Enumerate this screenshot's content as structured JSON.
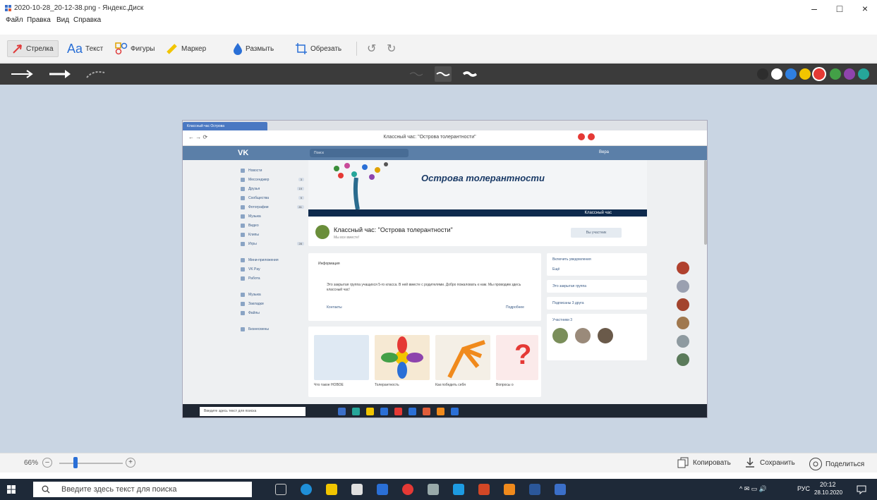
{
  "window": {
    "title": "2020-10-28_20-12-38.png - Яндекс.Диск",
    "minimize": "–",
    "maximize": "□",
    "close": "×"
  },
  "menu": [
    "Файл",
    "Правка",
    "Вид",
    "Справка"
  ],
  "toolbar": {
    "arrow": "Стрелка",
    "text": "Текст",
    "shapes": "Фигуры",
    "marker": "Маркер",
    "blur": "Размыть",
    "crop": "Обрезать",
    "undo": "↺",
    "redo": "↻"
  },
  "colors": [
    "#2d2d2d",
    "#ffffff",
    "#2f7fe0",
    "#f2c500",
    "#e53935",
    "#43a047",
    "#8e44ad",
    "#26a69a"
  ],
  "inner": {
    "tab_label": "Классный час Острова",
    "address": "Классный час: \"Острова толерантности\"",
    "vk_logo": "VK",
    "vk_search": "Поиск",
    "vk_user": "Вера",
    "nav": [
      {
        "label": "Новости",
        "count": ""
      },
      {
        "label": "Мессенджер",
        "count": "3"
      },
      {
        "label": "Друзья",
        "count": "19"
      },
      {
        "label": "Сообщества",
        "count": "9"
      },
      {
        "label": "Фотографии",
        "count": "81"
      },
      {
        "label": "Музыка",
        "count": ""
      },
      {
        "label": "Видео",
        "count": ""
      },
      {
        "label": "Клипы",
        "count": ""
      },
      {
        "label": "Игры",
        "count": "28"
      },
      {
        "label": "Мини-приложения",
        "count": ""
      },
      {
        "label": "VK Pay",
        "count": ""
      },
      {
        "label": "Работа",
        "count": ""
      },
      {
        "label": "Музыка",
        "count": ""
      },
      {
        "label": "Закладки",
        "count": ""
      },
      {
        "label": "Файлы",
        "count": ""
      },
      {
        "label": "Бизнесмены",
        "count": ""
      }
    ],
    "banner_title": "Острова толерантности",
    "banner_strip": "Классный час",
    "group_title": "Классный час: \"Острова толерантности\"",
    "group_sub": "Мы все вместе!",
    "subscribe": "Вы участник",
    "info_header": "Информация",
    "info_text": "Это закрытая группа учащихся 5-го класса. В ней вместе с родителями. Добро пожаловать к нам. Мы проводим здесь классный час!",
    "contacts": "Контакты",
    "more": "Подробнее",
    "albums": [
      {
        "label": "Что такое НОВОЕ",
        "color": "#dfe9f3"
      },
      {
        "label": "Толерантность",
        "color": "#f6e9d3"
      },
      {
        "label": "Как победить себя",
        "color": "#f4efe6"
      },
      {
        "label": "Вопросы о",
        "color": "#fbeaea"
      }
    ],
    "right": [
      "Включить уведомления",
      "Ещё",
      "Это закрытая группа",
      "Подписаны 3 друга",
      "Участники 3"
    ],
    "taskbar_search": "Введите здесь текст для поиска"
  },
  "bottom": {
    "zoom": "66%",
    "minus": "–",
    "plus": "+",
    "copy": "Копировать",
    "save": "Сохранить",
    "share": "Поделиться"
  },
  "taskbar": {
    "search": "Введите здесь текст для поиска",
    "lang": "РУС",
    "time": "20:12",
    "date": "28.10.2020"
  }
}
